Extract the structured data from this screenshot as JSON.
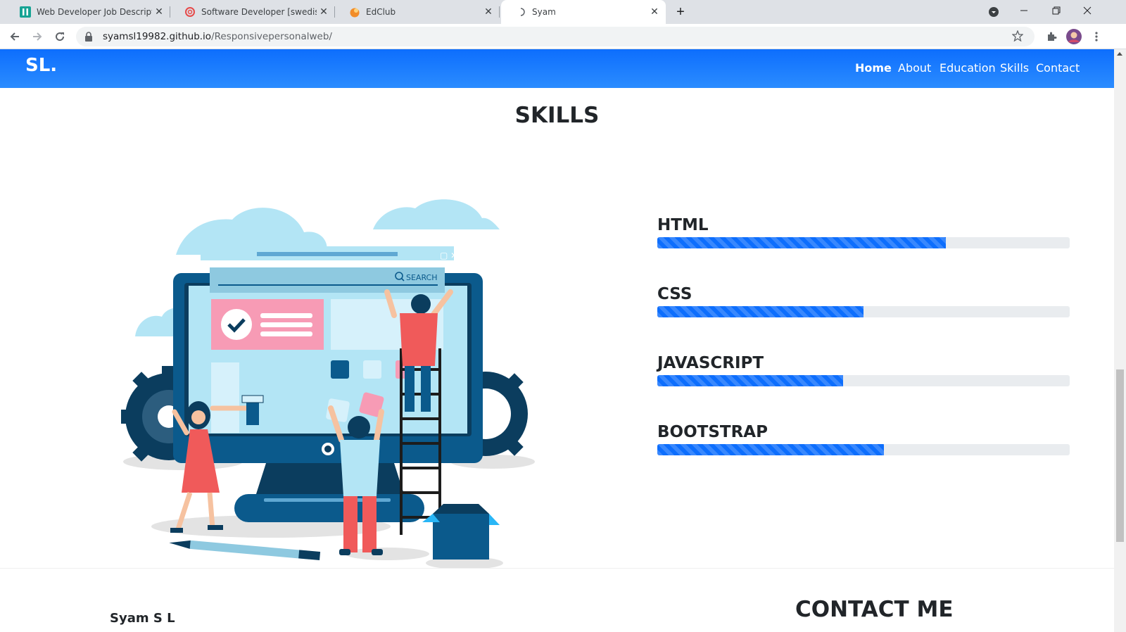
{
  "browser": {
    "tabs": [
      {
        "title": "Web Developer Job Description |",
        "icon": "teal-site-icon"
      },
      {
        "title": "Software Developer [swedish] Sy",
        "icon": "red-swirl-icon"
      },
      {
        "title": "EdClub",
        "icon": "edclub-icon"
      },
      {
        "title": "Syam",
        "icon": "loading-icon"
      }
    ],
    "url_domain": "syamsl19982.github.io",
    "url_path": "/Responsivepersonalweb/",
    "new_tab": "+"
  },
  "nav": {
    "brand": "SL.",
    "links": [
      "Home",
      "About",
      "Education",
      "Skills",
      "Contact"
    ],
    "active": "Home"
  },
  "skills": {
    "title": "SKILLS",
    "items": [
      {
        "name": "HTML",
        "percent": 70
      },
      {
        "name": "CSS",
        "percent": 50
      },
      {
        "name": "JAVASCRIPT",
        "percent": 45
      },
      {
        "name": "BOOTSTRAP",
        "percent": 55
      }
    ]
  },
  "illustration": {
    "search_label": "SEARCH"
  },
  "footer": {
    "name": "Syam S L",
    "contact_title": "CONTACT ME"
  },
  "colors": {
    "navbar": "#0d6efd",
    "progress": "#0d6efd",
    "track": "#e9ecef"
  }
}
